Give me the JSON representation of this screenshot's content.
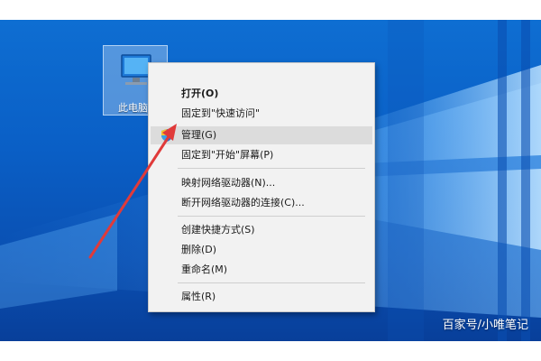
{
  "desktop_icon": {
    "icon": "computer-icon",
    "label": "此电脑"
  },
  "context_menu": {
    "items": [
      {
        "label": "打开(O)",
        "bold": true
      },
      {
        "label": "固定到\"快速访问\""
      },
      {
        "label": "管理(G)",
        "icon": "uac-shield-icon",
        "highlighted": true
      },
      {
        "label": "固定到\"开始\"屏幕(P)"
      },
      {
        "label": "映射网络驱动器(N)..."
      },
      {
        "label": "断开网络驱动器的连接(C)..."
      },
      {
        "label": "创建快捷方式(S)"
      },
      {
        "label": "删除(D)"
      },
      {
        "label": "重命名(M)"
      },
      {
        "label": "属性(R)"
      }
    ]
  },
  "annotation": {
    "icon": "red-arrow-icon",
    "color": "#e03a3a"
  },
  "watermark": "百家号/小唯笔记",
  "colors": {
    "desktop_blue": "#0a5fc6",
    "menu_bg": "#f2f2f2",
    "highlight": "#dcdcdc"
  }
}
